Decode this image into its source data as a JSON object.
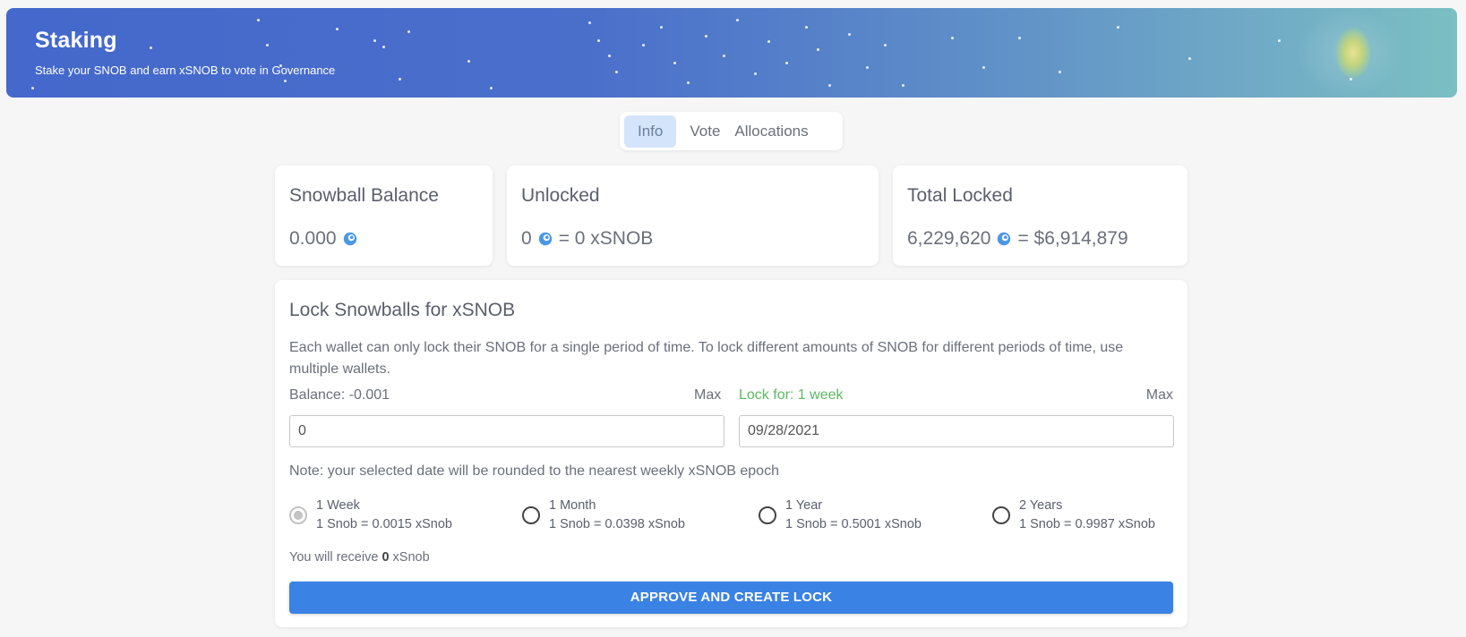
{
  "header": {
    "title": "Staking",
    "subtitle": "Stake your SNOB and earn xSNOB to vote in Governance"
  },
  "tabs": [
    {
      "label": "Info",
      "active": true
    },
    {
      "label": "Vote",
      "active": false
    },
    {
      "label": "Allocations",
      "active": false
    }
  ],
  "cards": {
    "balance": {
      "title": "Snowball Balance",
      "amount": "0.000"
    },
    "unlocked": {
      "title": "Unlocked",
      "amount": "0",
      "equals": "= 0 xSNOB"
    },
    "total_locked": {
      "title": "Total Locked",
      "amount": "6,229,620",
      "equals": "= $6,914,879"
    }
  },
  "lock": {
    "title": "Lock Snowballs for xSNOB",
    "description": "Each wallet can only lock their SNOB for a single period of time. To lock different amounts of SNOB for different periods of time, use multiple wallets.",
    "balance_label": "Balance: -0.001",
    "max_label_left": "Max",
    "lock_for_label": "Lock for: 1 week",
    "max_label_right": "Max",
    "amount_value": "0",
    "date_value": "09/28/2021",
    "note": "Note: your selected date will be rounded to the nearest weekly xSNOB epoch",
    "periods": [
      {
        "name": "1 Week",
        "rate": "1 Snob = 0.0015 xSnob",
        "selected": true
      },
      {
        "name": "1 Month",
        "rate": "1 Snob = 0.0398 xSnob",
        "selected": false
      },
      {
        "name": "1 Year",
        "rate": "1 Snob = 0.5001 xSnob",
        "selected": false
      },
      {
        "name": "2 Years",
        "rate": "1 Snob = 0.9987 xSnob",
        "selected": false
      }
    ],
    "receive_prefix": "You will receive",
    "receive_amount": "0",
    "receive_suffix": "xSnob",
    "button_label": "APPROVE AND CREATE LOCK"
  },
  "colors": {
    "accent": "#3a82e4",
    "lock_for_green": "#5cb860",
    "tab_active_bg": "#d4e4fa",
    "banner_start": "#4468cb",
    "banner_end": "#7bbfc3"
  },
  "icons": {
    "snob": "snowball-token-icon"
  }
}
